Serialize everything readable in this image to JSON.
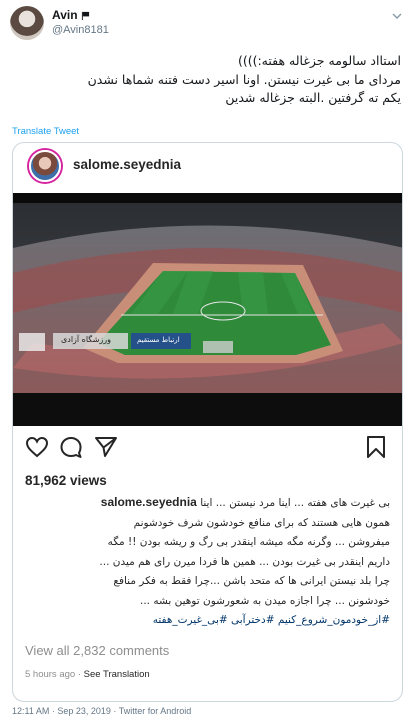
{
  "user": {
    "display_name": "Avin",
    "handle": "@Avin8181"
  },
  "tweet": {
    "lines": [
      "استااد سالومه جزغاله هفته:))))",
      "مردای ما بی غیرت نیستن. اونا اسیر دست فتنه شماها نشدن",
      "یکم ته گرفتین .البته جزغاله شدین"
    ],
    "translate_label": "Translate Tweet",
    "timestamp": "12:11 AM · Sep 23, 2019",
    "separator": " · ",
    "source": "Twitter for Android"
  },
  "instagram": {
    "username": "salome.seyednia",
    "views": "81,962 views",
    "caption_user": "salome.seyednia",
    "caption_lines": [
      "بی غیرت های هفته ... اینا مرد نیستن ... اینا",
      "همون هایی هستند که برای منافع خودشون شرف خودشونم",
      "میفروشن ... وگرنه مگه میشه اینقدر بی رگ و ریشه بودن !! مگه",
      "داریم اینقدر بی غیرت بودن ... همین ها فردا میرن رای هم میدن ...",
      "چرا بلد نیستن ایرانی ها که متحد باشن ...چرا فقط به فکر منافع",
      "خودشونن ... چرا اجازه میدن به شعورشون توهین بشه ..."
    ],
    "hashtags": "#از_خودمون_شروع_کنیم #دخترآبی #بی_غیرت_هفته",
    "view_comments": "View all 2,832 comments",
    "time_ago": "5 hours ago",
    "dot": " · ",
    "see_translation": "See Translation",
    "broadcast_text": "ورزشگاه آزادی",
    "broadcast_tag": "ارتباط مستقیم"
  },
  "colors": {
    "link": "#1da1f2",
    "hashtag": "#003569",
    "pitch": "#2f8a3a",
    "muted": "#657786"
  }
}
